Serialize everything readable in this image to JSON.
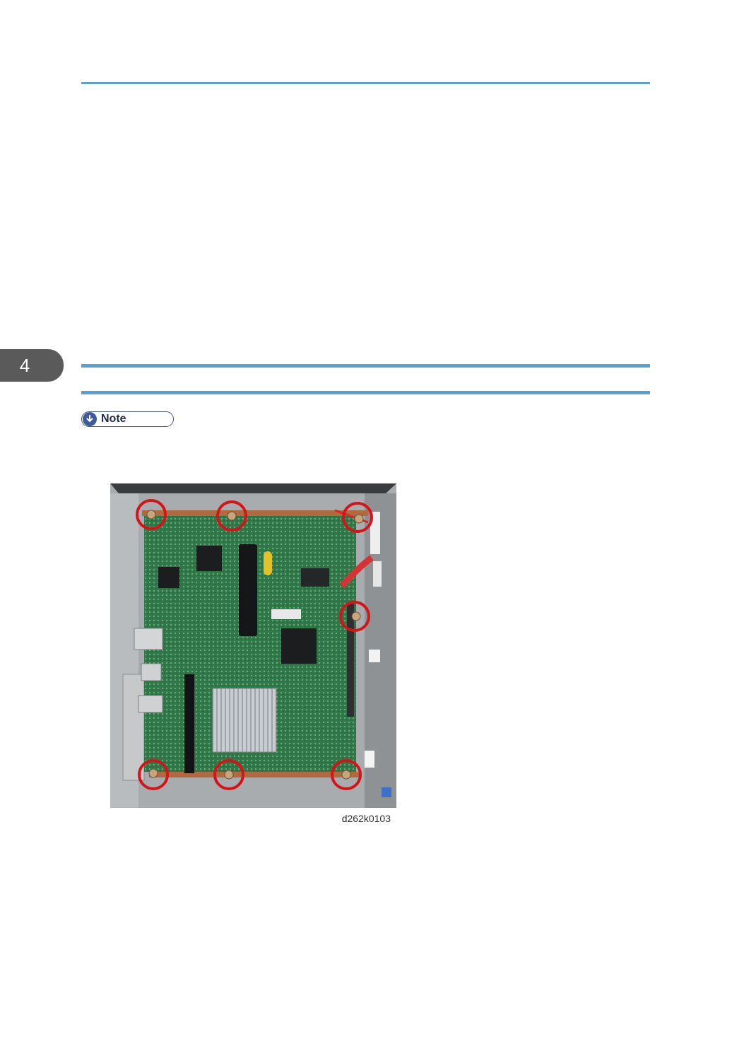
{
  "chapter": {
    "number": "4"
  },
  "note": {
    "label": "Note",
    "icon": "down-arrow-circle-icon"
  },
  "figure": {
    "caption": "d262k0103",
    "subject": "controller-board-screw-locations",
    "marker_color": "#d4141a"
  },
  "colors": {
    "accent_rule": "#5aa0d2",
    "tab": "#5a5a5a",
    "note": "#3f5a9e"
  }
}
